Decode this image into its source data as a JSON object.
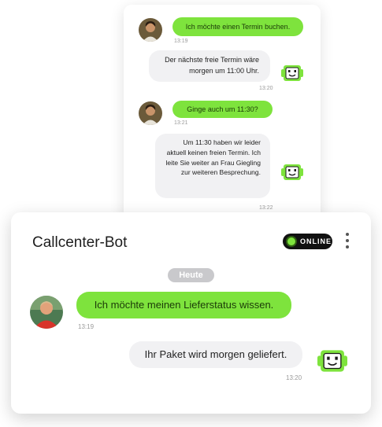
{
  "back_chat": {
    "messages": [
      {
        "sender": "user",
        "text": "Ich möchte einen Termin buchen.",
        "time": "13:19"
      },
      {
        "sender": "bot",
        "text": "Der nächste freie Termin wäre morgen um 11:00 Uhr.",
        "time": "13:20"
      },
      {
        "sender": "user",
        "text": "Ginge auch um 11:30?",
        "time": "13:21"
      },
      {
        "sender": "bot",
        "text": "Um 11:30 haben wir leider aktuell keinen freien Termin. Ich leite Sie weiter an Frau Giegling zur weiteren Besprechung.",
        "time": "13:22"
      }
    ]
  },
  "front_chat": {
    "title": "Callcenter-Bot",
    "status": "ONLINE",
    "day_label": "Heute",
    "messages": [
      {
        "sender": "user",
        "text": "Ich möchte meinen Lieferstatus wissen.",
        "time": "13:19"
      },
      {
        "sender": "bot",
        "text": "Ihr Paket wird morgen geliefert.",
        "time": "13:20"
      }
    ]
  },
  "colors": {
    "accent_green": "#7ee33d",
    "bot_bubble": "#f1f1f3",
    "online_badge": "#111111"
  },
  "icons": [
    "user-avatar",
    "bot-icon",
    "more-options-icon",
    "online-dot-icon"
  ]
}
